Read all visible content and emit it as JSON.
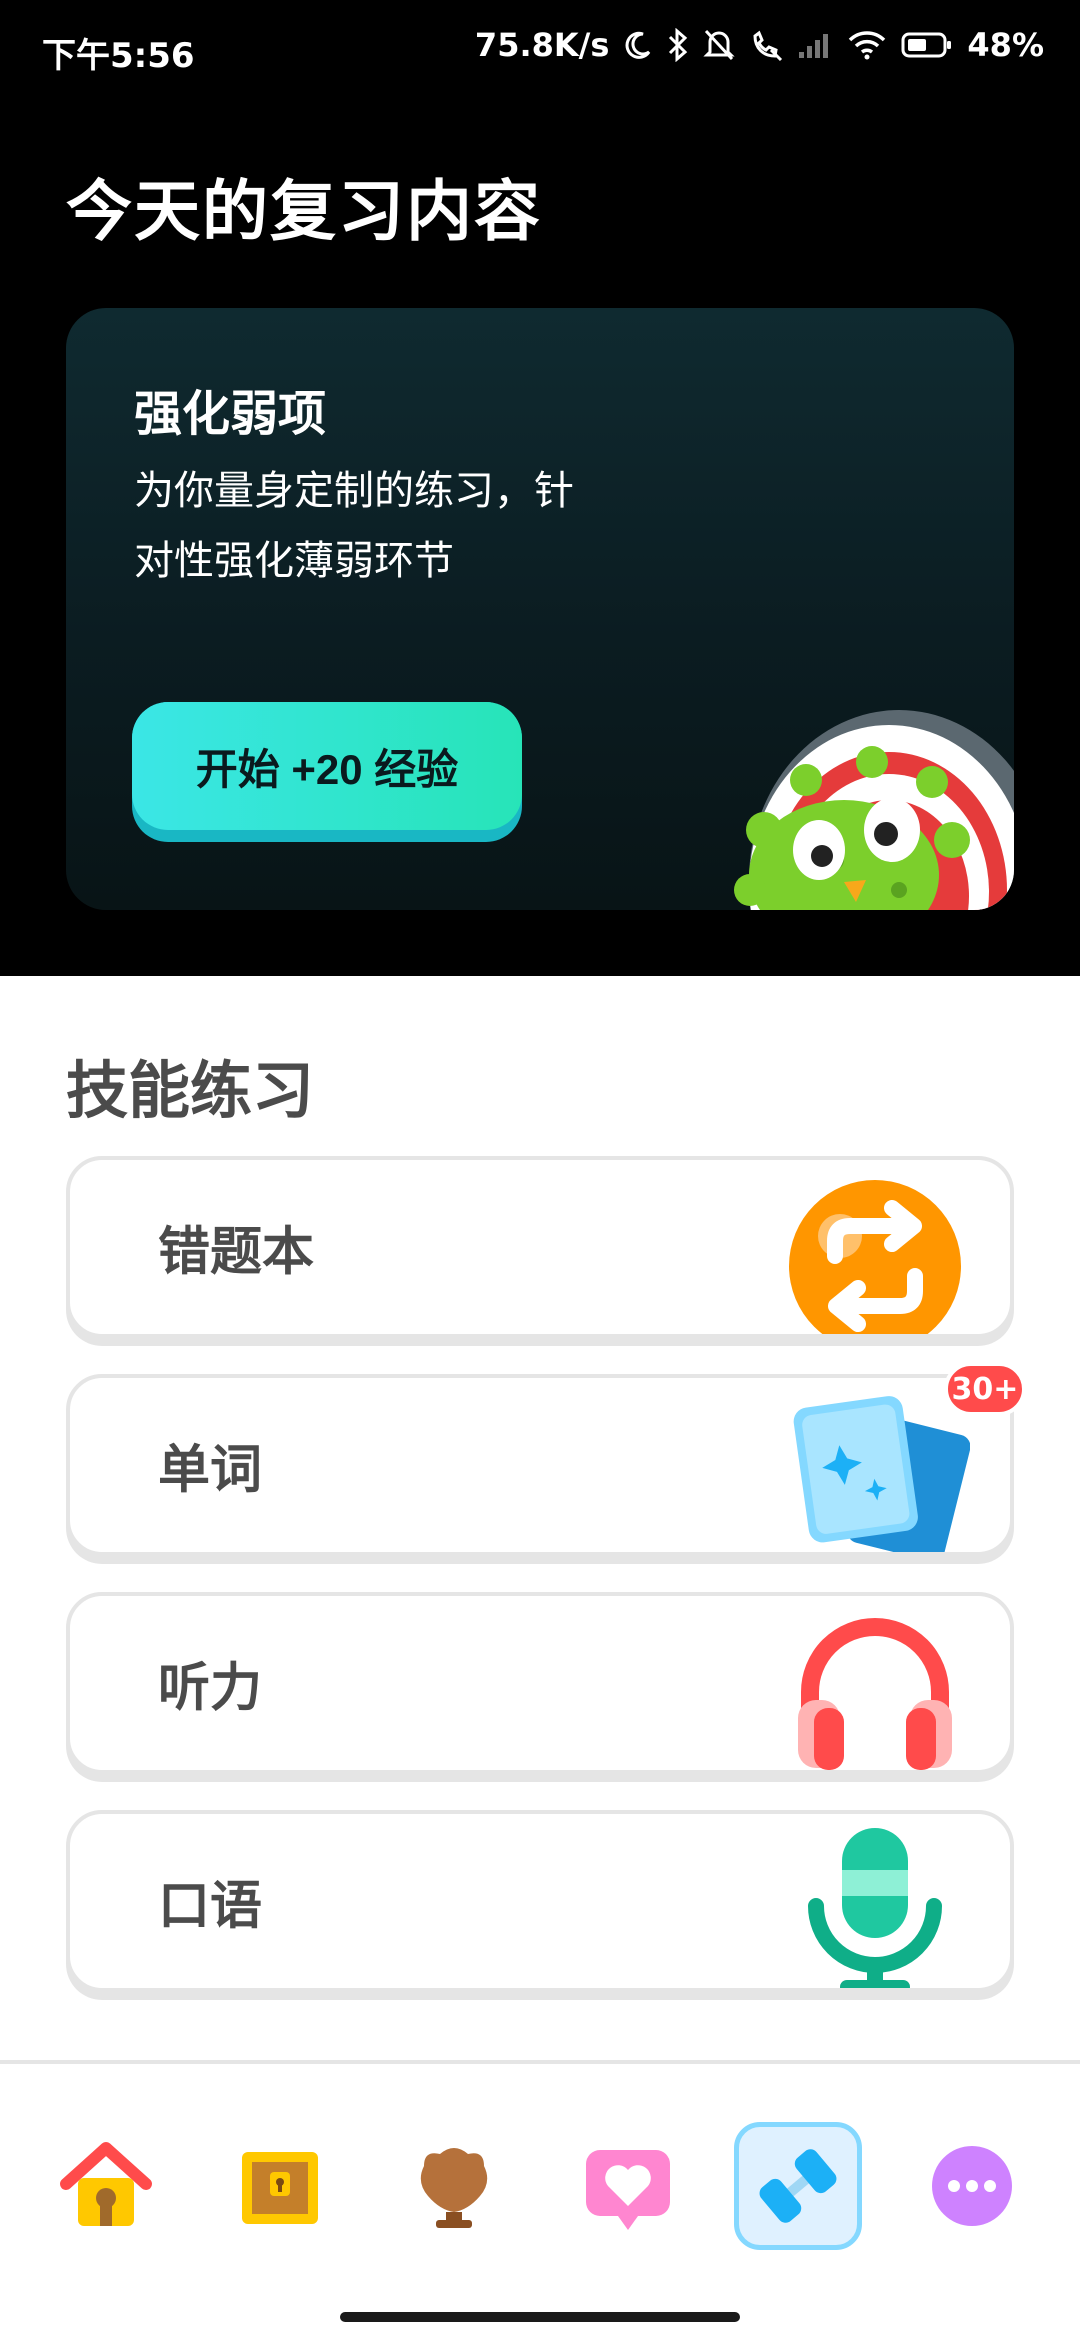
{
  "status_bar": {
    "time": "下午5:56",
    "net_speed": "75.8K/s",
    "battery": "48%",
    "icons": [
      "moon-icon",
      "bluetooth-icon",
      "mute-icon",
      "call-icon",
      "signal-icon",
      "wifi-icon",
      "battery-icon"
    ]
  },
  "page": {
    "title": "今天的复习内容"
  },
  "review_card": {
    "title": "强化弱项",
    "desc_line1": "为你量身定制的练习，针",
    "desc_line2": "对性强化薄弱环节",
    "button": "开始 +20 经验"
  },
  "skills": {
    "title": "技能练习",
    "items": [
      {
        "label": "错题本",
        "icon": "repeat-icon"
      },
      {
        "label": "单词",
        "icon": "flashcards-icon",
        "badge": "30+"
      },
      {
        "label": "听力",
        "icon": "headphones-icon"
      },
      {
        "label": "口语",
        "icon": "microphone-icon"
      }
    ]
  },
  "nav": {
    "items": [
      "home-icon",
      "treasure-chest-icon",
      "shield-icon",
      "heart-icon",
      "dumbbell-icon",
      "more-icon"
    ],
    "active": "dumbbell-icon"
  },
  "colors": {
    "accent": "#1cb0f6",
    "button_start": "#3be6e6",
    "button_end": "#27e4b8",
    "badge": "#ff4b4b"
  }
}
